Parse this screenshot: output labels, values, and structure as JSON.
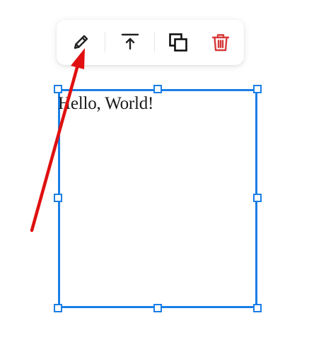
{
  "toolbar": {
    "buttons": [
      {
        "name": "edit",
        "icon": "pencil-icon",
        "color": "#222222"
      },
      {
        "name": "bring-to-front",
        "icon": "bring-to-front-icon",
        "color": "#222222"
      },
      {
        "name": "duplicate",
        "icon": "duplicate-icon",
        "color": "#111111"
      },
      {
        "name": "delete",
        "icon": "trash-icon",
        "color": "#d63b3b"
      }
    ]
  },
  "canvas": {
    "text_box": {
      "text": "Hello, World!",
      "selection_color": "#1a7ee6"
    }
  },
  "annotation": {
    "arrow_color": "#e01010",
    "points_to": "edit"
  }
}
